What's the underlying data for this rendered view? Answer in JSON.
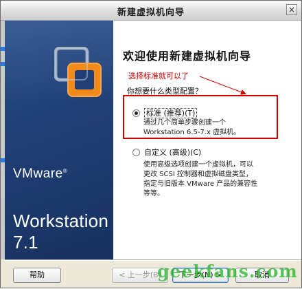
{
  "window": {
    "title": "新建虚拟机向导",
    "close_glyph": "×"
  },
  "sidebar": {
    "brand": "VMware",
    "brand_mark": "®",
    "product": "Workstation 7.1"
  },
  "main": {
    "heading": "欢迎使用新建虚拟机向导",
    "annotation": "选择标准就可以了",
    "question": "你想要什么类型配置？",
    "options": [
      {
        "label": "标准 (推荐)(T)",
        "selected": true,
        "desc": [
          "通过几个简单步骤创建一个",
          "Workstation 6.5-7.x 虚拟机。"
        ]
      },
      {
        "label": "自定义 (高级)(C)",
        "selected": false,
        "desc": [
          "使用高级选项创建一个虚拟机，可以",
          "更改 SCSI 控制器和虚拟磁盘类型，",
          "指定与旧版本 VMware 产品的兼容性",
          "等等。"
        ]
      }
    ]
  },
  "buttons": {
    "help": "帮助",
    "back": "< 上一步(B)",
    "next": "下一步(N) >",
    "cancel": "取消"
  },
  "watermark": "geekfans.com",
  "colors": {
    "annotation": "#d10000",
    "sidebar": "#1f3f75",
    "watermark": "#2fb52f"
  },
  "icons": {
    "logo": "vmware-logo",
    "close": "close-icon"
  }
}
